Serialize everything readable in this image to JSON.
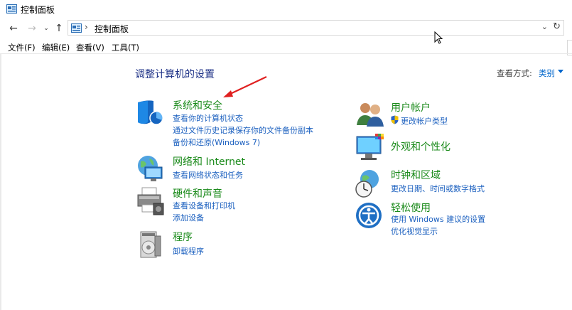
{
  "window": {
    "title": "控制面板"
  },
  "address": {
    "crumb": "控制面板"
  },
  "menu": [
    "文件(F)",
    "编辑(E)",
    "查看(V)",
    "工具(T)"
  ],
  "content": {
    "heading": "调整计算机的设置",
    "view_by_label": "查看方式:",
    "view_by_value": "类别"
  },
  "categories": {
    "system_security": {
      "title": "系统和安全",
      "links": [
        "查看你的计算机状态",
        "通过文件历史记录保存你的文件备份副本",
        "备份和还原(Windows 7)"
      ]
    },
    "network": {
      "title": "网络和 Internet",
      "links": [
        "查看网络状态和任务"
      ]
    },
    "hardware": {
      "title": "硬件和声音",
      "links": [
        "查看设备和打印机",
        "添加设备"
      ]
    },
    "programs": {
      "title": "程序",
      "links": [
        "卸载程序"
      ]
    },
    "user_accounts": {
      "title": "用户帐户",
      "links": [
        "更改帐户类型"
      ]
    },
    "appearance": {
      "title": "外观和个性化",
      "links": []
    },
    "clock_region": {
      "title": "时钟和区域",
      "links": [
        "更改日期、时间或数字格式"
      ]
    },
    "ease_access": {
      "title": "轻松使用",
      "links": [
        "使用 Windows 建议的设置",
        "优化视觉显示"
      ]
    }
  },
  "colors": {
    "heading": "#1e3287",
    "category_title": "#1a8a1a",
    "link": "#1a5fbf",
    "annotation_arrow": "#e02020"
  }
}
